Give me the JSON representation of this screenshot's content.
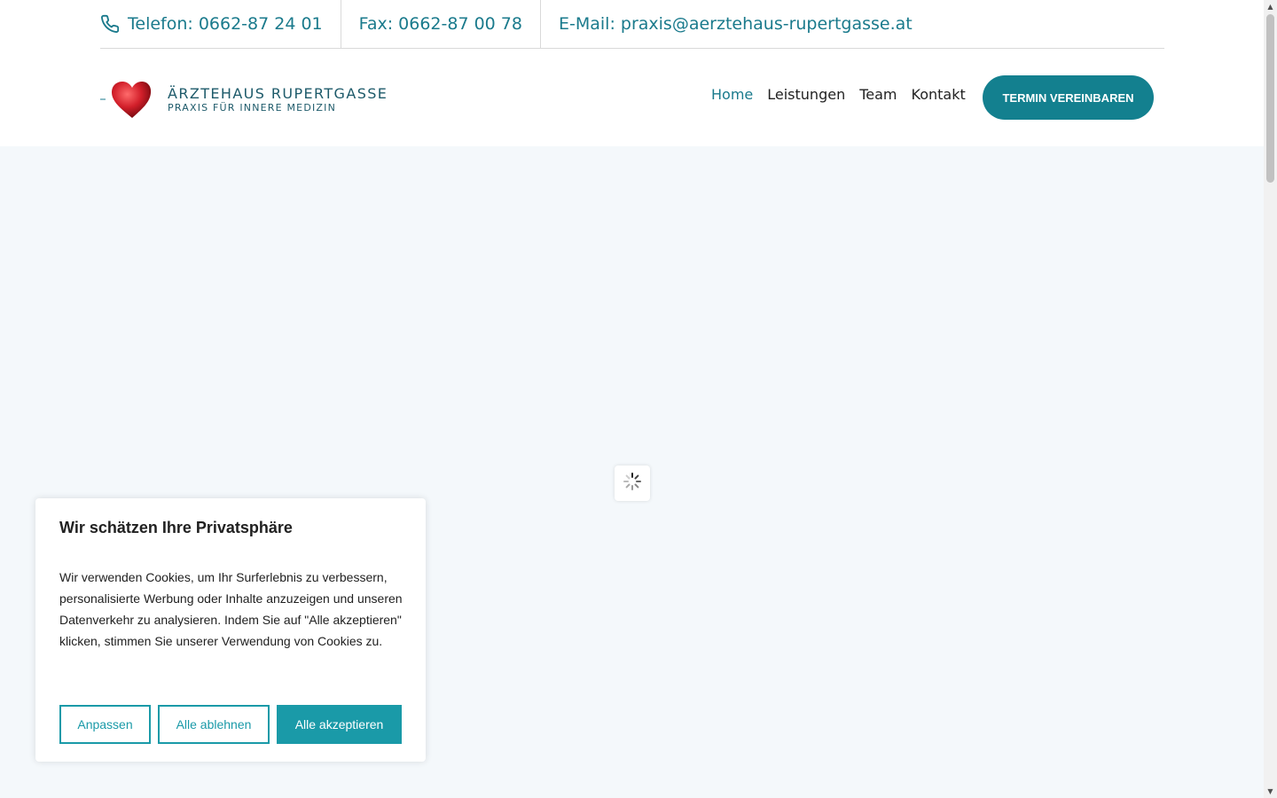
{
  "topbar": {
    "phone_text": "Telefon: 0662-87 24 01",
    "fax_text": "Fax: 0662-87 00 78",
    "email_text": "E-Mail: praxis@aerztehaus-rupertgasse.at",
    "phone_icon": "phone-icon"
  },
  "logo": {
    "title": "ÄRZTEHAUS RUPERTGASSE",
    "subtitle": "PRAXIS FÜR INNERE MEDIZIN",
    "icon": "heart-icon"
  },
  "nav": {
    "items": [
      {
        "label": "Home",
        "active": true
      },
      {
        "label": "Leistungen",
        "active": false
      },
      {
        "label": "Team",
        "active": false
      },
      {
        "label": "Kontakt",
        "active": false
      }
    ],
    "cta_label": "TERMIN VEREINBAREN"
  },
  "hero": {
    "loader_icon": "spinner-icon"
  },
  "cookie": {
    "title": "Wir schätzen Ihre Privatsphäre",
    "text": "Wir verwenden Cookies, um Ihr Surferlebnis zu verbessern, personalisierte Werbung oder Inhalte anzuzeigen und unseren Datenverkehr zu analysieren. Indem Sie auf \"Alle akzeptieren\" klicken, stimmen Sie unserer Verwendung von Cookies zu.",
    "customize_label": "Anpassen",
    "reject_label": "Alle ablehnen",
    "accept_label": "Alle akzeptieren"
  },
  "colors": {
    "accent": "#13808f",
    "link": "#1a7a8c",
    "cookie_accent": "#1a9aa8",
    "hero_bg": "#f4f8fb"
  }
}
